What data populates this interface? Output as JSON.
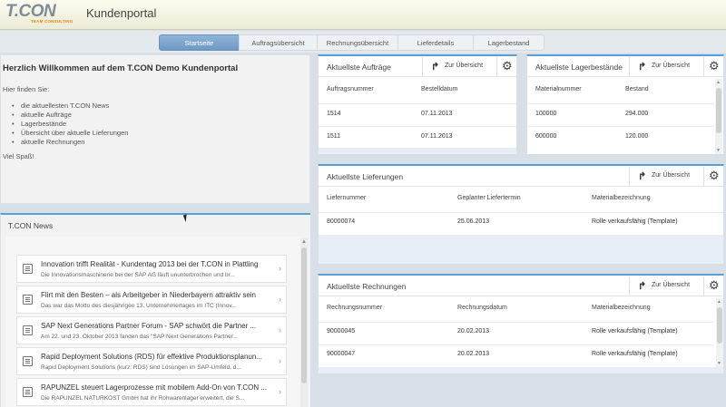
{
  "header": {
    "logo_main": "T.CON",
    "logo_sub": "TEAM CONSULTING",
    "title": "Kundenportal"
  },
  "tabs": [
    "Startseite",
    "Auftragsübersicht",
    "Rechnungsübersicht",
    "Lieferdetails",
    "Lagerbestand"
  ],
  "welcome": {
    "title": "Herzlich Willkommen auf dem T.CON Demo Kundenportal",
    "intro": "Hier finden Sie:",
    "items": [
      "die aktuellesten T.CON News",
      "aktuelle Aufträge",
      "Lagerbestände",
      "Übersicht über aktuelle Lieferungen",
      "aktuelle Rechnungen"
    ],
    "outro": "Viel Spaß!"
  },
  "news": {
    "title": "T.CON News",
    "items": [
      {
        "head": "Innovation trifft Realität - Kundentag 2013 bei der T.CON in Plattling",
        "sub": "Die Innovationsmaschinerie bei der SAP AG läuft ununterbrochen und br..."
      },
      {
        "head": "Flirt mit den Besten – als Arbeitgeber in Niederbayern attraktiv sein",
        "sub": "Das war das Motto des diesjährigen 13. Unternehmertages im ITC (Innov..."
      },
      {
        "head": "SAP Next Generations Partner Forum - SAP schwört die Partner ...",
        "sub": "Am 22. und 23. Oktober 2013 fanden das \"SAP Next Generations Partner..."
      },
      {
        "head": "Rapid Deployment Solutions (RDS) für effektive Produktionsplanun...",
        "sub": "Rapid Deployment Solutions (kurz: RDS) sind Lösungen im SAP-Umfeld, d..."
      },
      {
        "head": "RAPUNZEL steuert Lagerprozesse mit mobilem Add-On von T.CON ...",
        "sub": "Die RAPUNZEL NATURKOST GmbH hat ihr Rohwarenlager erweitert, die S..."
      }
    ]
  },
  "overview_label": "Zur Übersicht",
  "orders": {
    "title": "Aktuellste Aufträge",
    "headers": [
      "Auftragsnummer",
      "Bestelldatum"
    ],
    "rows": [
      [
        "1514",
        "07.11.2013"
      ],
      [
        "1511",
        "07.11.2013"
      ]
    ]
  },
  "stock": {
    "title": "Aktuellste Lagerbestände",
    "headers": [
      "Materialnummer",
      "Bestand"
    ],
    "rows": [
      [
        "100000",
        "294.000"
      ],
      [
        "600000",
        "120.000"
      ]
    ]
  },
  "deliveries": {
    "title": "Aktuellste Lieferungen",
    "headers": [
      "Liefernummer",
      "Geplanter Liefertermin",
      "Materialbezeichnung"
    ],
    "rows": [
      [
        "80000074",
        "25.06.2013",
        "Rolle verkaufsfähig (Template)"
      ]
    ]
  },
  "invoices": {
    "title": "Aktuellste Rechnungen",
    "headers": [
      "Rechnungsnummer",
      "Rechnungsdatum",
      "Materialbezeichnung"
    ],
    "rows": [
      [
        "90000045",
        "20.02.2013",
        "Rolle verkaufsfähig (Template)"
      ],
      [
        "90000047",
        "20.02.2013",
        "Rolle verkaufsfähig (Template)"
      ]
    ]
  },
  "icons": {
    "overview": "share-arrow-icon",
    "settings": "gear-icon",
    "news": "document-icon",
    "chevron": "chevron-right-icon"
  },
  "colors": {
    "accent": "#5aa0d6",
    "active_tab": "#7ba3cd",
    "logo_orange": "#e88410"
  }
}
